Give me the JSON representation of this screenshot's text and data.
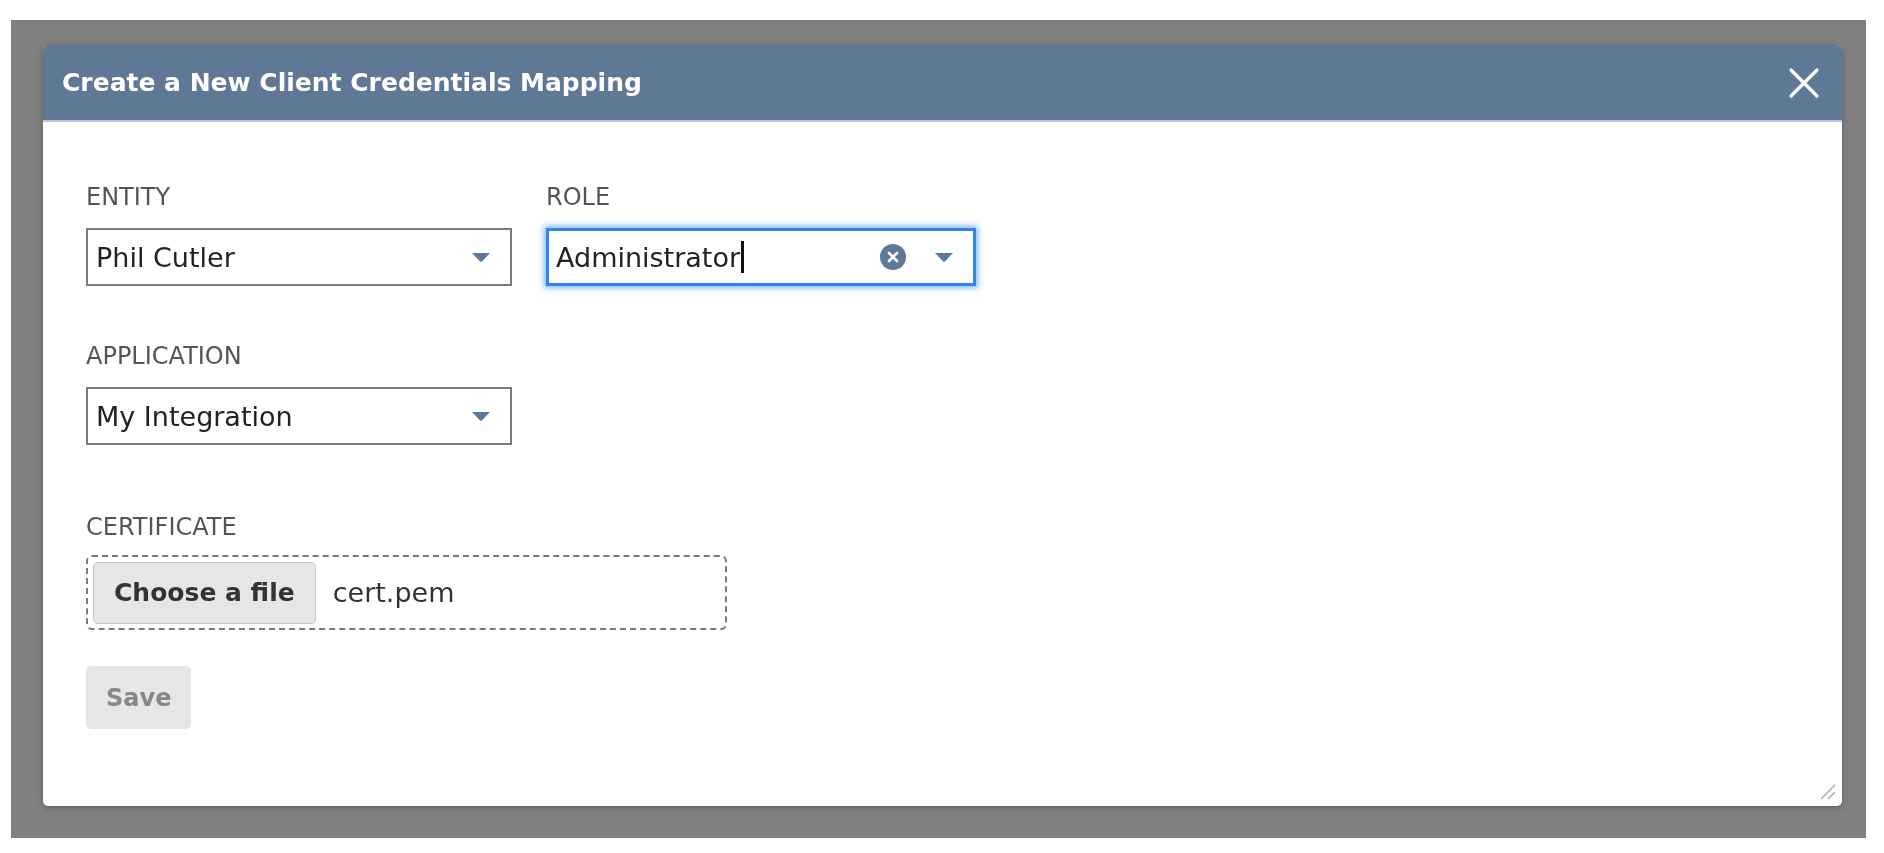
{
  "dialog": {
    "title": "Create a New Client Credentials Mapping"
  },
  "form": {
    "rows": [
      {
        "fields": [
          {
            "kind": "select",
            "label": "ENTITY",
            "value": "Phil Cutler",
            "focused": false,
            "clearable": false
          },
          {
            "kind": "select",
            "label": "ROLE",
            "value": "Administrator",
            "focused": true,
            "clearable": true
          }
        ]
      },
      {
        "fields": [
          {
            "kind": "select",
            "label": "APPLICATION",
            "value": "My Integration",
            "focused": false,
            "clearable": false
          }
        ]
      },
      {
        "fields": [
          {
            "kind": "file",
            "label": "CERTIFICATE",
            "button": "Choose a file",
            "file_name": "cert.pem"
          }
        ]
      }
    ]
  },
  "save_button": {
    "label": "Save",
    "disabled": true
  }
}
